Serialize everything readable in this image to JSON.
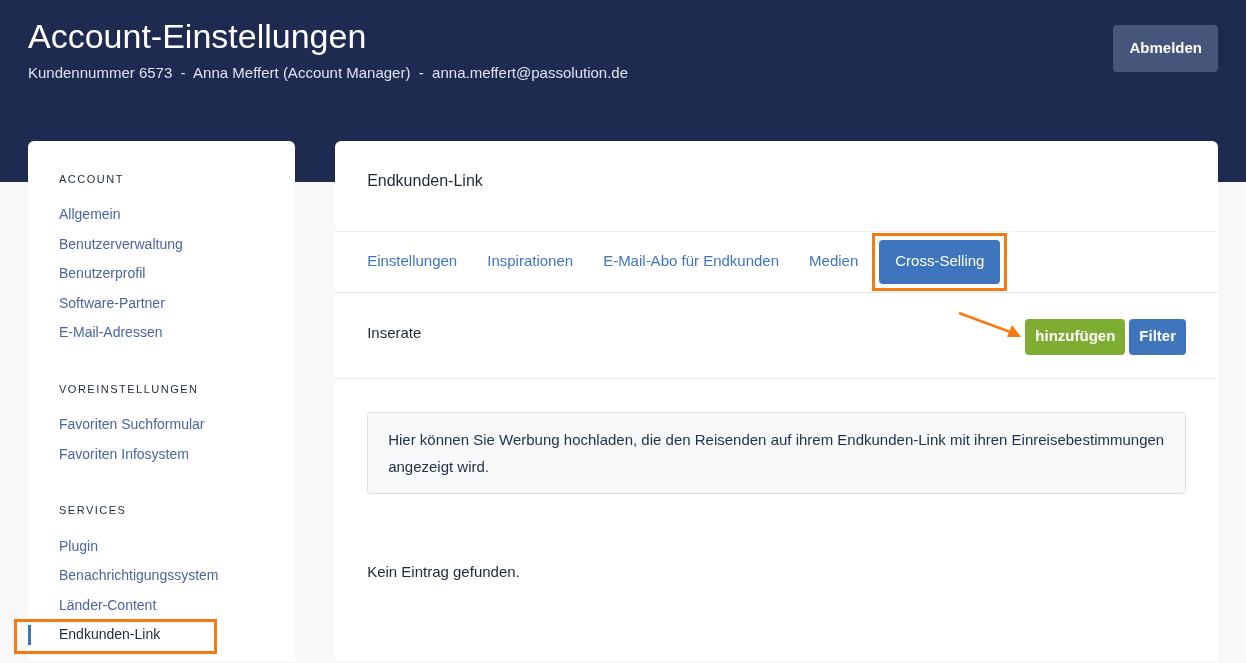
{
  "header": {
    "title": "Account-Einstellungen",
    "subtitle": "Kundennummer 6573  -  Anna Meffert (Account Manager)  -  anna.meffert@passolution.de",
    "logout_button": "Abmelden"
  },
  "sidebar": {
    "sections": [
      {
        "heading": "ACCOUNT",
        "items": [
          {
            "label": "Allgemein",
            "selected": false
          },
          {
            "label": "Benutzerverwaltung",
            "selected": false
          },
          {
            "label": "Benutzerprofil",
            "selected": false
          },
          {
            "label": "Software-Partner",
            "selected": false
          },
          {
            "label": "E-Mail-Adressen",
            "selected": false
          }
        ]
      },
      {
        "heading": "VOREINSTELLUNGEN",
        "items": [
          {
            "label": "Favoriten Suchformular",
            "selected": false
          },
          {
            "label": "Favoriten Infosystem",
            "selected": false
          }
        ]
      },
      {
        "heading": "SERVICES",
        "items": [
          {
            "label": "Plugin",
            "selected": false
          },
          {
            "label": "Benachrichtigungssystem",
            "selected": false
          },
          {
            "label": "Länder-Content",
            "selected": false
          },
          {
            "label": "Endkunden-Link",
            "selected": true
          }
        ]
      }
    ]
  },
  "main": {
    "title": "Endkunden-Link",
    "tabs": [
      {
        "label": "Einstellungen",
        "selected": false
      },
      {
        "label": "Inspirationen",
        "selected": false
      },
      {
        "label": "E-Mail-Abo für Endkunden",
        "selected": false
      },
      {
        "label": "Medien",
        "selected": false
      },
      {
        "label": "Cross-Selling",
        "selected": true
      }
    ],
    "section_title": "Inserate",
    "add_button": "hinzufügen",
    "filter_button": "Filter",
    "info": "Hier können Sie Werbung hochladen, die den Reisenden auf ihrem Endkunden-Link mit ihren Einreisebestimmungen angezeigt wird.",
    "empty_message": "Kein Eintrag gefunden."
  }
}
